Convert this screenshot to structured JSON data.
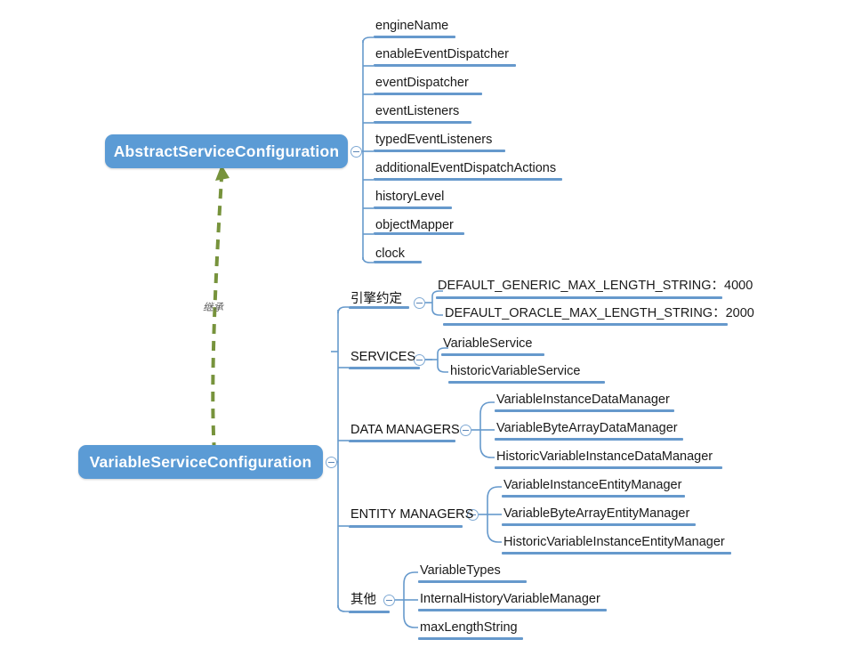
{
  "diagram": {
    "title": "VariableServiceConfiguration class diagram",
    "colors": {
      "node_fill": "#5B9BD5",
      "node_text": "#ffffff",
      "branch_line": "#6699CC",
      "underline_bar": "#6699CC",
      "inherit_arrow": "#77933C",
      "leaf_text": "#1a1a1a"
    },
    "relation": {
      "label": "继承",
      "from": "VariableServiceConfiguration",
      "to": "AbstractServiceConfiguration",
      "style": "dashed-arrow"
    },
    "nodes": [
      {
        "id": "abstract",
        "label": "AbstractServiceConfiguration"
      },
      {
        "id": "variable",
        "label": "VariableServiceConfiguration"
      }
    ],
    "abstract_children": [
      {
        "label": "engineName",
        "bar": 92
      },
      {
        "label": "enableEventDispatcher",
        "bar": 160
      },
      {
        "label": "eventDispatcher",
        "bar": 122
      },
      {
        "label": "eventListeners",
        "bar": 110
      },
      {
        "label": "typedEventListeners",
        "bar": 148
      },
      {
        "label": "additionalEventDispatchActions",
        "bar": 212
      },
      {
        "label": "historyLevel",
        "bar": 88
      },
      {
        "label": "objectMapper",
        "bar": 102
      },
      {
        "label": "clock",
        "bar": 54
      }
    ],
    "variable_groups": [
      {
        "label": "引擎约定",
        "bar": 68,
        "items": [
          {
            "label": "DEFAULT_GENERIC_MAX_LENGTH_STRING：4000",
            "bar": 320
          },
          {
            "label": "DEFAULT_ORACLE_MAX_LENGTH_STRING：2000",
            "bar": 320
          }
        ]
      },
      {
        "label": "SERVICES",
        "bar": 80,
        "items": [
          {
            "label": "VariableService",
            "bar": 116
          },
          {
            "label": "historicVariableService",
            "bar": 176
          }
        ]
      },
      {
        "label": "DATA MANAGERS",
        "bar": 120,
        "items": [
          {
            "label": "VariableInstanceDataManager",
            "bar": 202
          },
          {
            "label": "VariableByteArrayDataManager",
            "bar": 212
          },
          {
            "label": "HistoricVariableInstanceDataManager",
            "bar": 256
          }
        ]
      },
      {
        "label": "ENTITY MANAGERS",
        "bar": 134,
        "items": [
          {
            "label": "VariableInstanceEntityManager",
            "bar": 206
          },
          {
            "label": "VariableByteArrayEntityManager",
            "bar": 218
          },
          {
            "label": "HistoricVariableInstanceEntityManager",
            "bar": 262
          }
        ]
      },
      {
        "label": "其他",
        "bar": 58,
        "items": [
          {
            "label": "VariableTypes",
            "bar": 122
          },
          {
            "label": "InternalHistoryVariableManager",
            "bar": 212
          },
          {
            "label": "maxLengthString",
            "bar": 118
          }
        ]
      }
    ]
  }
}
